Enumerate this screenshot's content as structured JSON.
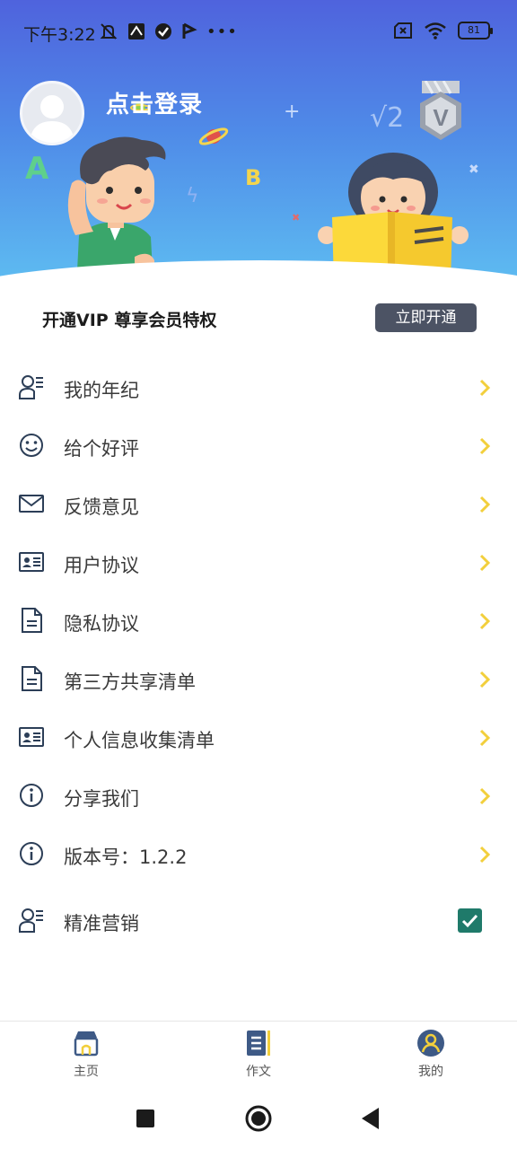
{
  "status_bar": {
    "time": "下午3:22",
    "battery": "81"
  },
  "profile": {
    "login_label": "点击登录"
  },
  "vip": {
    "promo_text": "开通VIP 尊享会员特权",
    "button_label": "立即开通"
  },
  "menu": {
    "items": [
      {
        "label": "我的年纪",
        "icon": "user-list-icon"
      },
      {
        "label": "给个好评",
        "icon": "smiley-icon"
      },
      {
        "label": "反馈意见",
        "icon": "mail-icon"
      },
      {
        "label": "用户协议",
        "icon": "id-card-icon"
      },
      {
        "label": "隐私协议",
        "icon": "document-icon"
      },
      {
        "label": "第三方共享清单",
        "icon": "document-icon"
      },
      {
        "label": "个人信息收集清单",
        "icon": "id-card-icon"
      },
      {
        "label": "分享我们",
        "icon": "info-icon"
      },
      {
        "label": "版本号：1.2.2",
        "icon": "info-icon"
      }
    ],
    "marketing": {
      "label": "精准营销",
      "icon": "user-list-icon",
      "checked": true
    }
  },
  "tabbar": {
    "tabs": [
      {
        "label": "主页",
        "icon": "shop-icon"
      },
      {
        "label": "作文",
        "icon": "notebook-icon"
      },
      {
        "label": "我的",
        "icon": "person-icon"
      }
    ]
  },
  "illustration": {
    "letter_a": "A",
    "letter_b": "B",
    "sqrt": "√2",
    "badge": "V"
  },
  "colors": {
    "accent_arrow": "#f2cf3c",
    "vip_button": "#4c5364",
    "checkbox": "#1f7a6a",
    "icon_stroke": "#2c3e57"
  }
}
